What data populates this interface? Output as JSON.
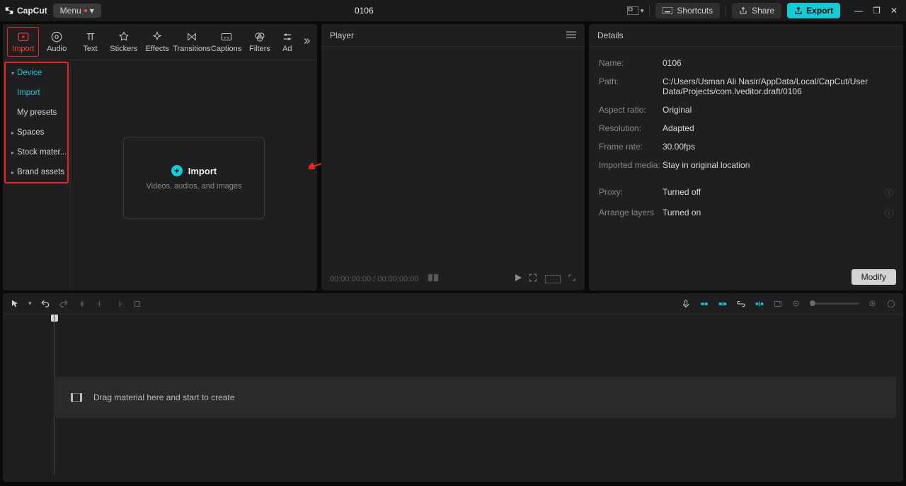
{
  "title": "0106",
  "app": "CapCut",
  "menu_label": "Menu",
  "titlebar": {
    "shortcuts": "Shortcuts",
    "share": "Share",
    "export": "Export"
  },
  "tabs": {
    "import": "Import",
    "audio": "Audio",
    "text": "Text",
    "stickers": "Stickers",
    "effects": "Effects",
    "transitions": "Transitions",
    "captions": "Captions",
    "filters": "Filters",
    "adjust": "Ad"
  },
  "sidebar": {
    "device": "Device",
    "import": "Import",
    "presets": "My presets",
    "spaces": "Spaces",
    "stock": "Stock mater...",
    "brand": "Brand assets"
  },
  "dropzone": {
    "title": "Import",
    "sub": "Videos, audios, and images"
  },
  "player": {
    "title": "Player",
    "time_current": "00:00:00:00",
    "time_total": "00:00:00:00",
    "sep": " / "
  },
  "details": {
    "title": "Details",
    "name_k": "Name:",
    "name_v": "0106",
    "path_k": "Path:",
    "path_v": "C:/Users/Usman Ali Nasir/AppData/Local/CapCut/User Data/Projects/com.lveditor.draft/0106",
    "aspect_k": "Aspect ratio:",
    "aspect_v": "Original",
    "res_k": "Resolution:",
    "res_v": "Adapted",
    "fps_k": "Frame rate:",
    "fps_v": "30.00fps",
    "imp_k": "Imported media:",
    "imp_v": "Stay in original location",
    "proxy_k": "Proxy:",
    "proxy_v": "Turned off",
    "layers_k": "Arrange layers",
    "layers_v": "Turned on",
    "modify": "Modify"
  },
  "timeline": {
    "placeholder": "Drag material here and start to create"
  }
}
